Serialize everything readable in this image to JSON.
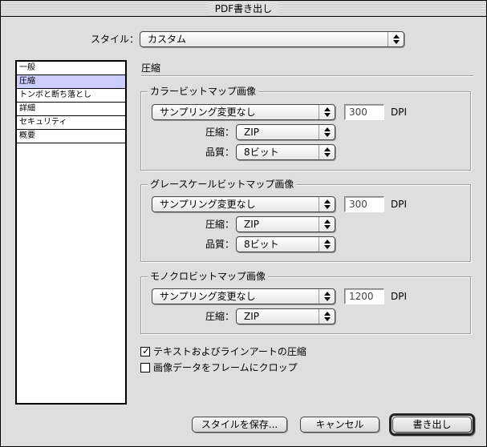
{
  "window": {
    "title": "PDF書き出し"
  },
  "style_row": {
    "label": "スタイル：",
    "value": "カスタム"
  },
  "sidebar": {
    "items": [
      {
        "label": "一般",
        "selected": false
      },
      {
        "label": "圧縮",
        "selected": true
      },
      {
        "label": "トンボと断ち落とし",
        "selected": false
      },
      {
        "label": "詳細",
        "selected": false
      },
      {
        "label": "セキュリティ",
        "selected": false
      },
      {
        "label": "概要",
        "selected": false
      }
    ]
  },
  "panel": {
    "heading": "圧縮"
  },
  "color_group": {
    "title": "カラービットマップ画像",
    "sampling": "サンプリング変更なし",
    "dpi_value": "300",
    "dpi_unit": "DPI",
    "compression_label": "圧縮：",
    "compression_value": "ZIP",
    "quality_label": "品質：",
    "quality_value": "8ビット"
  },
  "gray_group": {
    "title": "グレースケールビットマップ画像",
    "sampling": "サンプリング変更なし",
    "dpi_value": "300",
    "dpi_unit": "DPI",
    "compression_label": "圧縮：",
    "compression_value": "ZIP",
    "quality_label": "品質：",
    "quality_value": "8ビット"
  },
  "mono_group": {
    "title": "モノクロビットマップ画像",
    "sampling": "サンプリング変更なし",
    "dpi_value": "1200",
    "dpi_unit": "DPI",
    "compression_label": "圧縮：",
    "compression_value": "ZIP"
  },
  "options": {
    "compress_text": {
      "label": "テキストおよびラインアートの圧縮",
      "checked": true,
      "mark": "✓"
    },
    "crop_images": {
      "label": "画像データをフレームにクロップ",
      "checked": false
    }
  },
  "buttons": {
    "save_style": "スタイルを保存...",
    "cancel": "キャンセル",
    "export": "書き出し"
  }
}
